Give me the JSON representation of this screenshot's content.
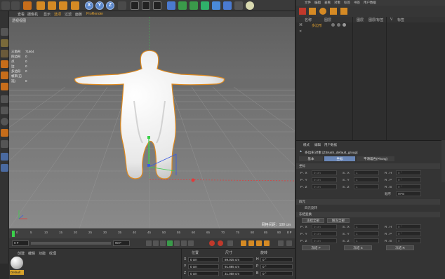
{
  "toolbar": {
    "axis_x": "X",
    "axis_y": "Y",
    "axis_z": "Z"
  },
  "viewport": {
    "menu": [
      "查看",
      "摄像机",
      "显示",
      "选项",
      "过滤",
      "面板",
      "ProRender"
    ],
    "label": "透视视图",
    "stats": [
      {
        "k": "对象",
        "v": "1"
      },
      {
        "k": "三角形",
        "v": "71604"
      },
      {
        "k": "四边形",
        "v": "0"
      },
      {
        "k": "点",
        "v": "0"
      },
      {
        "k": "边",
        "v": "0"
      },
      {
        "k": "多边形",
        "v": "0"
      },
      {
        "k": "帧率(已选)",
        "v": "0"
      }
    ],
    "grid_spacing": "网格间距：100 cm"
  },
  "timeline": {
    "ticks": [
      "0",
      "5",
      "10",
      "15",
      "20",
      "25",
      "30",
      "35",
      "40",
      "45",
      "50",
      "55",
      "60",
      "65",
      "70",
      "75",
      "80",
      "85",
      "90"
    ],
    "end_label": "0 F",
    "start_frame": "0 F",
    "end_frame": "90 F",
    "current_frame": "0 F",
    "max_frame": "90 F"
  },
  "material_manager": {
    "menu": [
      "创建",
      "编辑",
      "功能",
      "纹理"
    ],
    "material_name": "Default"
  },
  "coordinates": {
    "headers": {
      "position": "位置",
      "size": "尺寸",
      "rotation": "旋转"
    },
    "rows": [
      {
        "axis": "X",
        "pos": "0 cm",
        "size": "89.035 cm",
        "rot_axis": "H",
        "rot": "0 °"
      },
      {
        "axis": "Y",
        "pos": "0 cm",
        "size": "91.885 cm",
        "rot_axis": "P",
        "rot": "0 °"
      },
      {
        "axis": "Z",
        "pos": "0 cm",
        "size": "31.058 cm",
        "rot_axis": "B",
        "rot": "0 °"
      }
    ]
  },
  "object_manager": {
    "menu": [
      "文件",
      "编辑",
      "查看",
      "对象",
      "标签",
      "书签",
      "用户数据"
    ],
    "head": [
      "名称",
      "图层",
      "编辑器",
      "渲染器"
    ],
    "right_head": [
      "图层",
      "图层/标签",
      "V",
      "标签"
    ],
    "object_name": "多边形"
  },
  "attributes": {
    "menu": [
      "模式",
      "编辑",
      "用户数据"
    ],
    "title": "多边形对象 [ZBrush_default_group]",
    "tabs": [
      "基本",
      "坐标",
      "平滑着色(Phong)"
    ],
    "coord_section": "坐标",
    "quaternion_section": "四元",
    "freeze_section": "冻结变换",
    "rows": [
      {
        "p": "P . X",
        "pv": "0 cm",
        "s": "S . X",
        "sv": "1",
        "r": "R . H",
        "rv": "0 °"
      },
      {
        "p": "P . Y",
        "pv": "0 cm",
        "s": "S . Y",
        "sv": "1",
        "r": "R . P",
        "rv": "0 °"
      },
      {
        "p": "P . Z",
        "pv": "0 cm",
        "s": "S . Z",
        "sv": "1",
        "r": "R . B",
        "rv": "0 °"
      }
    ],
    "order_label": "顺序",
    "order_value": "HPB",
    "quaternion_check": "四元旋转",
    "freeze_all": "冻结全部",
    "unfreeze_all": "解冻全部",
    "freeze_rows": [
      {
        "p": "P . X",
        "pv": "0 cm",
        "s": "S . X",
        "sv": "1",
        "r": "R . H",
        "rv": "0 °"
      },
      {
        "p": "P . Y",
        "pv": "0 cm",
        "s": "S . Y",
        "sv": "1",
        "r": "R . P",
        "rv": "0 °"
      },
      {
        "p": "P . Z",
        "pv": "0 cm",
        "s": "S . Z",
        "sv": "1",
        "r": "R . B",
        "rv": "0 °"
      }
    ],
    "freeze_p": "冻结 P",
    "freeze_s": "冻结 S",
    "freeze_r": "冻结 R"
  },
  "colors": {
    "accent_orange": "#e08a1e",
    "axis_x": "#e23a3a",
    "axis_y": "#3ad04a",
    "axis_z": "#3a5ae2",
    "tab_active": "#6a87b8"
  },
  "icons": [
    "undo-icon",
    "select-icon",
    "move-icon",
    "scale-icon",
    "rotate-icon",
    "render-icon",
    "cube-icon",
    "pen-icon",
    "camera-icon",
    "light-icon"
  ]
}
